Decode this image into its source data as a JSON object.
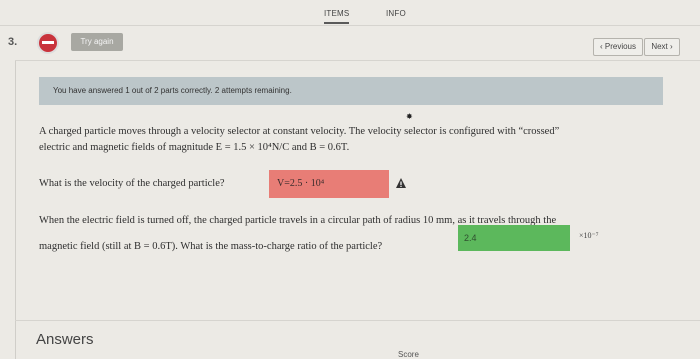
{
  "tabs": {
    "items": "ITEMS",
    "info": "INFO"
  },
  "question": {
    "number": "3.",
    "status": "incorrect",
    "try_again": "Try again",
    "nav": {
      "previous": "‹ Previous",
      "next": "Next ›"
    },
    "banner": "You have answered 1 out of 2 parts correctly. 2 attempts remaining.",
    "prompt_line1": "A charged particle moves through a velocity selector at constant velocity. The velocity selector is configured with “crossed”",
    "prompt_line2": "electric and magnetic fields of magnitude E = 1.5 × 10⁴N/C and B = 0.6T.",
    "part1_question": "What is the velocity of the charged particle?",
    "part1_answer": "V=2.5 · 10⁴",
    "part1_status": "incorrect",
    "part2_line1": "When the electric field is turned off, the charged particle travels in a circular path of radius 10 mm, as it travels through the",
    "part2_line2": "magnetic field (still at B = 0.6T). What is the mass-to-charge ratio of the particle?",
    "part2_answer": "2.4",
    "part2_status": "correct",
    "part2_unit": "×10⁻⁷"
  },
  "answers_section": {
    "title": "Answers",
    "score_label": "Score"
  },
  "colors": {
    "incorrect": "#e87d76",
    "correct": "#5cb85c",
    "status_dot": "#c9333c",
    "banner": "#bcc6c9"
  }
}
